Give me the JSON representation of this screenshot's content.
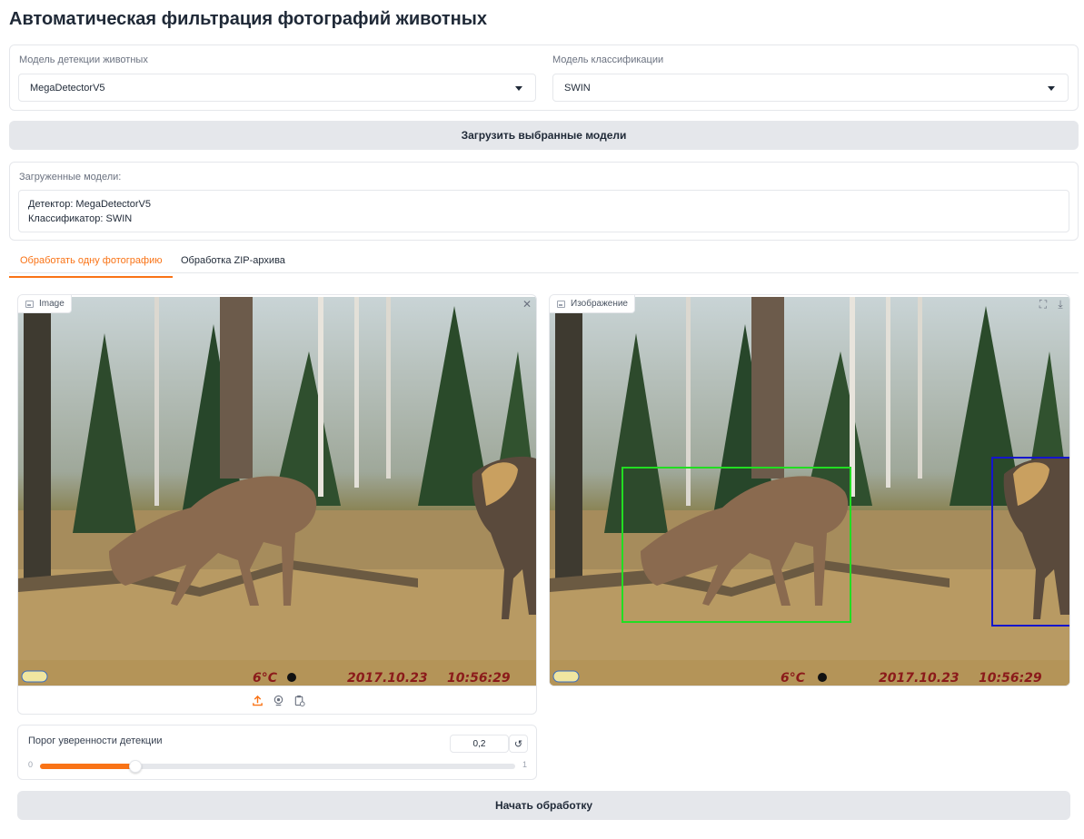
{
  "page": {
    "title": "Автоматическая фильтрация фотографий животных"
  },
  "detector_select": {
    "label": "Модель детекции животных",
    "value": "MegaDetectorV5"
  },
  "classifier_select": {
    "label": "Модель классификации",
    "value": "SWIN"
  },
  "load_button": {
    "label": "Загрузить выбранные модели"
  },
  "loaded_models": {
    "label": "Загруженные модели:",
    "detector_line": "Детектор: MegaDetectorV5",
    "classifier_line": "Классификатор: SWIN"
  },
  "tabs": [
    {
      "label": "Обработать одну фотографию",
      "active": true
    },
    {
      "label": "Обработка ZIP-архива",
      "active": false
    }
  ],
  "input_image": {
    "tag": "Image"
  },
  "output_image": {
    "tag": "Изображение"
  },
  "photo_overlay": {
    "temperature": "6°C",
    "date": "2017.10.23",
    "time": "10:56:29"
  },
  "threshold_slider": {
    "label": "Порог уверенности детекции",
    "value_text": "0,2",
    "value": 0.2,
    "min": "0",
    "max": "1"
  },
  "start_button": {
    "label": "Начать обработку"
  },
  "colors": {
    "accent": "#f97316",
    "box_green": "#22dd22",
    "box_blue": "#1515cc"
  }
}
